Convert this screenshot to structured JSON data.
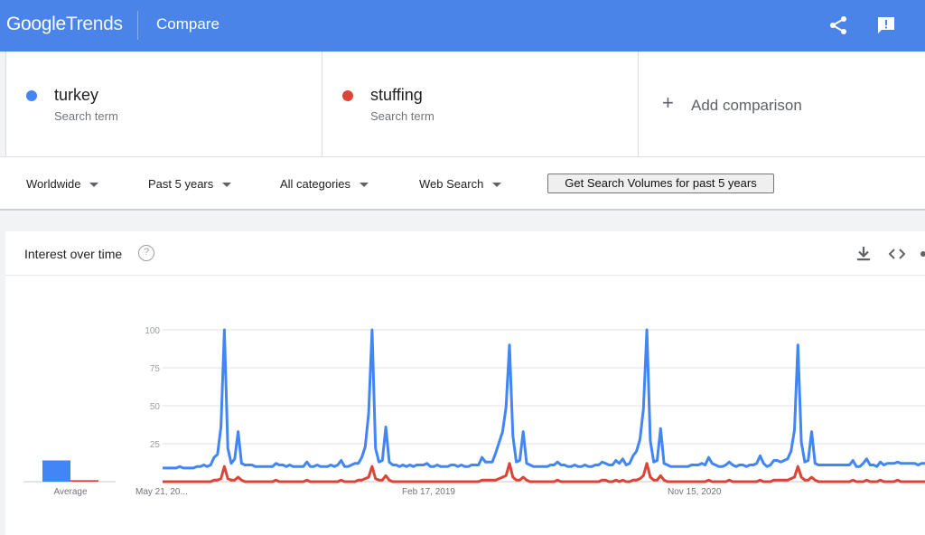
{
  "header": {
    "logo_google": "Google",
    "logo_trends": "Trends",
    "title": "Compare",
    "share_icon": "share-icon",
    "feedback_icon": "feedback-icon",
    "background": "#4a84e8"
  },
  "terms": [
    {
      "name": "turkey",
      "sub": "Search term",
      "color": "#4285f4"
    },
    {
      "name": "stuffing",
      "sub": "Search term",
      "color": "#db4437"
    }
  ],
  "add_comparison": {
    "plus": "+",
    "label": "Add comparison"
  },
  "filters": {
    "region": "Worldwide",
    "time": "Past 5 years",
    "category": "All categories",
    "property": "Web Search",
    "volume_button": "Get Search Volumes for past 5 years"
  },
  "card": {
    "title": "Interest over time",
    "help": "?",
    "download_icon": "download-icon",
    "embed_icon": "embed-icon",
    "share_icon": "share-icon"
  },
  "chart_data": {
    "type": "line",
    "ylim": [
      0,
      100
    ],
    "yticks": [
      25,
      50,
      75,
      100
    ],
    "x_tick_labels": [
      "May 21, 20...",
      "Feb 17, 2019",
      "Nov 15, 2020"
    ],
    "average_label": "Average",
    "average": [
      {
        "name": "turkey",
        "value": 14
      },
      {
        "name": "stuffing",
        "value": 1
      }
    ],
    "series": [
      {
        "name": "turkey",
        "color": "#4285f4",
        "values": [
          9,
          9,
          9,
          9,
          9,
          10,
          9,
          9,
          9,
          9,
          10,
          10,
          11,
          10,
          11,
          16,
          18,
          36,
          100,
          22,
          12,
          15,
          33,
          12,
          11,
          11,
          11,
          10,
          10,
          10,
          10,
          10,
          10,
          12,
          11,
          11,
          10,
          11,
          10,
          10,
          10,
          10,
          13,
          10,
          10,
          11,
          10,
          10,
          10,
          11,
          10,
          11,
          14,
          10,
          10,
          11,
          12,
          12,
          16,
          23,
          45,
          100,
          22,
          13,
          14,
          36,
          13,
          11,
          11,
          10,
          11,
          10,
          11,
          10,
          11,
          11,
          11,
          12,
          10,
          10,
          11,
          10,
          10,
          10,
          11,
          11,
          10,
          11,
          10,
          10,
          11,
          11,
          11,
          16,
          13,
          13,
          13,
          19,
          26,
          33,
          49,
          90,
          30,
          13,
          14,
          33,
          12,
          11,
          10,
          10,
          10,
          10,
          10,
          11,
          11,
          13,
          11,
          11,
          10,
          10,
          11,
          10,
          10,
          11,
          10,
          10,
          11,
          11,
          13,
          12,
          11,
          11,
          14,
          12,
          15,
          11,
          12,
          17,
          20,
          28,
          48,
          100,
          27,
          13,
          14,
          35,
          12,
          11,
          10,
          10,
          10,
          10,
          10,
          10,
          11,
          11,
          11,
          12,
          11,
          16,
          12,
          11,
          10,
          10,
          11,
          13,
          11,
          10,
          11,
          11,
          10,
          11,
          11,
          12,
          17,
          12,
          10,
          11,
          14,
          14,
          13,
          14,
          15,
          20,
          34,
          90,
          26,
          13,
          14,
          33,
          12,
          11,
          11,
          11,
          11,
          11,
          11,
          11,
          11,
          11,
          11,
          14,
          10,
          10,
          12,
          15,
          11,
          11,
          10,
          13,
          11,
          12,
          12,
          12,
          13,
          12,
          12,
          12,
          12,
          12,
          11,
          12,
          12
        ]
      },
      {
        "name": "stuffing",
        "color": "#db4437",
        "values": [
          0,
          0,
          0,
          0,
          0,
          0,
          0,
          0,
          0,
          0,
          0,
          0,
          0,
          0,
          0,
          1,
          1,
          2,
          10,
          2,
          1,
          1,
          3,
          1,
          0,
          0,
          0,
          0,
          0,
          0,
          0,
          0,
          0,
          1,
          0,
          0,
          0,
          0,
          0,
          0,
          0,
          0,
          1,
          0,
          0,
          0,
          0,
          0,
          0,
          0,
          0,
          0,
          1,
          0,
          0,
          0,
          0,
          1,
          1,
          2,
          3,
          10,
          2,
          1,
          1,
          4,
          1,
          0,
          0,
          0,
          0,
          0,
          0,
          0,
          0,
          0,
          0,
          0,
          0,
          0,
          0,
          0,
          0,
          0,
          0,
          0,
          0,
          0,
          0,
          0,
          0,
          0,
          0,
          1,
          1,
          1,
          1,
          1,
          2,
          3,
          4,
          12,
          3,
          1,
          1,
          3,
          1,
          0,
          0,
          0,
          0,
          0,
          0,
          0,
          0,
          1,
          0,
          0,
          0,
          0,
          0,
          0,
          0,
          0,
          0,
          0,
          0,
          0,
          1,
          1,
          0,
          0,
          1,
          0,
          1,
          0,
          0,
          1,
          1,
          2,
          4,
          12,
          3,
          1,
          1,
          4,
          1,
          0,
          0,
          0,
          0,
          0,
          0,
          0,
          0,
          0,
          0,
          0,
          0,
          1,
          0,
          0,
          0,
          0,
          0,
          1,
          0,
          0,
          0,
          0,
          0,
          0,
          0,
          0,
          1,
          0,
          0,
          0,
          1,
          1,
          1,
          1,
          1,
          2,
          3,
          10,
          3,
          1,
          1,
          3,
          1,
          0,
          0,
          0,
          0,
          0,
          0,
          0,
          0,
          0,
          0,
          1,
          0,
          0,
          0,
          1,
          0,
          0,
          0,
          1,
          0,
          0,
          0,
          0,
          1,
          0,
          0,
          0,
          0,
          0,
          0,
          0,
          0
        ]
      }
    ]
  }
}
